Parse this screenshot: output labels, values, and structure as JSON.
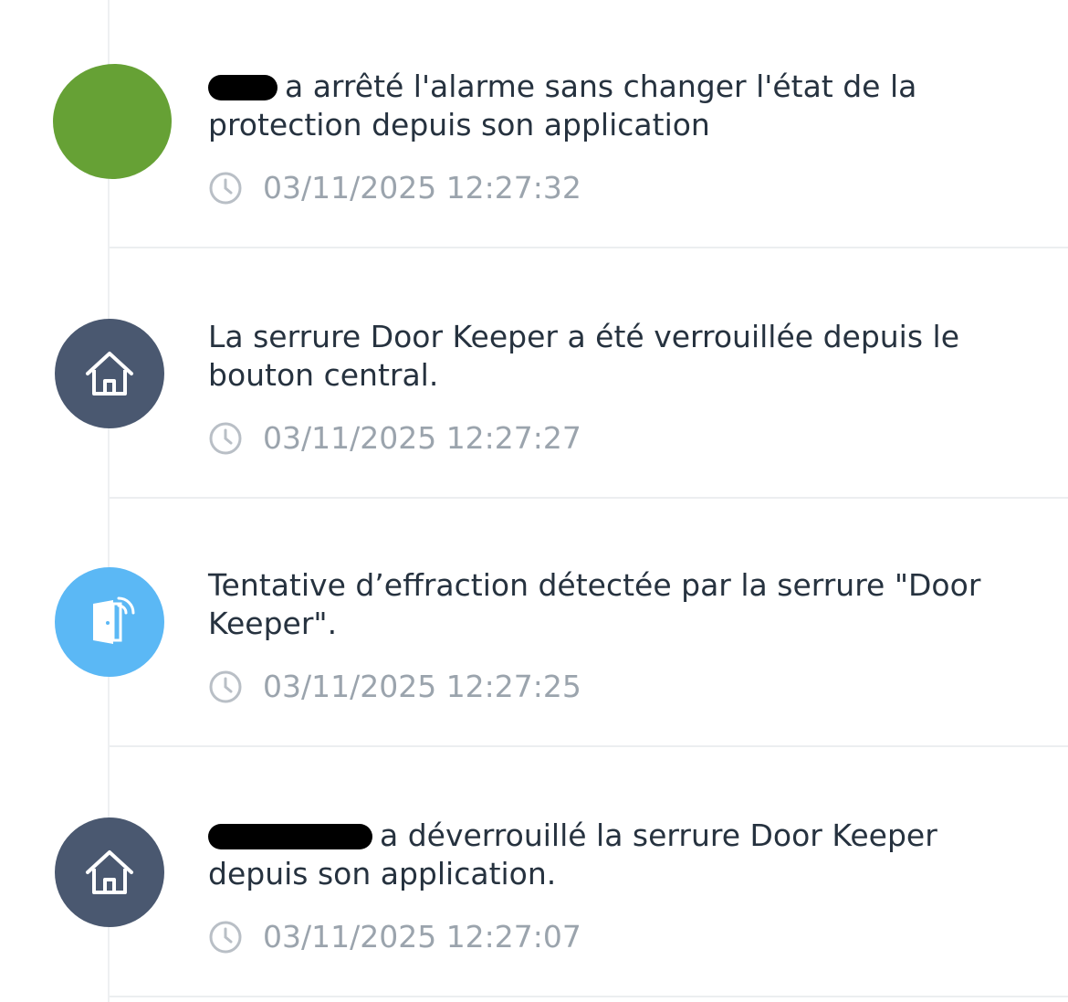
{
  "events": [
    {
      "icon": "user-avatar",
      "actor_hidden": true,
      "message": "a arrêté l'alarme sans changer l'état de la protection depuis son application",
      "timestamp": "03/11/2025 12:27:32"
    },
    {
      "icon": "home-icon",
      "message": "La serrure Door Keeper a été verrouillée depuis le bouton central.",
      "timestamp": "03/11/2025 12:27:27"
    },
    {
      "icon": "door-alert-icon",
      "message": "Tentative d’effraction détectée par la serrure \"Door Keeper\".",
      "timestamp": "03/11/2025 12:27:25"
    },
    {
      "icon": "home-icon",
      "actor_hidden": true,
      "message": "a déverrouillé la serrure Door Keeper depuis son application.",
      "timestamp": "03/11/2025 12:27:07"
    }
  ],
  "colors": {
    "home_badge": "#4a5870",
    "alert_badge": "#5bb8f5",
    "user_badge": "#66a135",
    "text": "#26323f",
    "timestamp": "#9ba4ad"
  }
}
